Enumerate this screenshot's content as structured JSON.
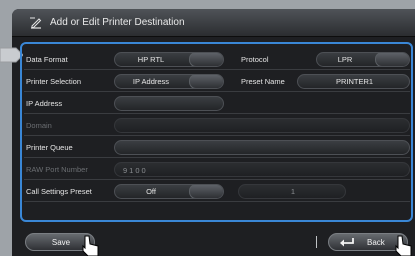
{
  "window": {
    "title": "Add or Edit Printer Destination"
  },
  "icons": {
    "title": "edit-destination-icon",
    "pointer": "arrow-pointer-icon",
    "cursor": "hand-cursor-icon",
    "back": "back-return-icon"
  },
  "colors": {
    "accent": "#3a87d6",
    "panel": "#1e1f22"
  },
  "form": {
    "data_format": {
      "label": "Data Format",
      "value": "HP RTL"
    },
    "protocol": {
      "label": "Protocol",
      "value": "LPR"
    },
    "printer_selection": {
      "label": "Printer Selection",
      "value": "IP Address"
    },
    "preset_name": {
      "label": "Preset Name",
      "value": "PRINTER1"
    },
    "ip_address": {
      "label": "IP Address",
      "value": ""
    },
    "domain": {
      "label": "Domain",
      "value": ""
    },
    "printer_queue": {
      "label": "Printer Queue",
      "value": ""
    },
    "raw_port": {
      "label": "RAW Port Number",
      "value": "9100"
    },
    "call_settings_preset": {
      "label": "Call Settings Preset",
      "value": "Off",
      "preset_number": "1"
    }
  },
  "footer": {
    "save_label": "Save",
    "back_label": "Back"
  }
}
